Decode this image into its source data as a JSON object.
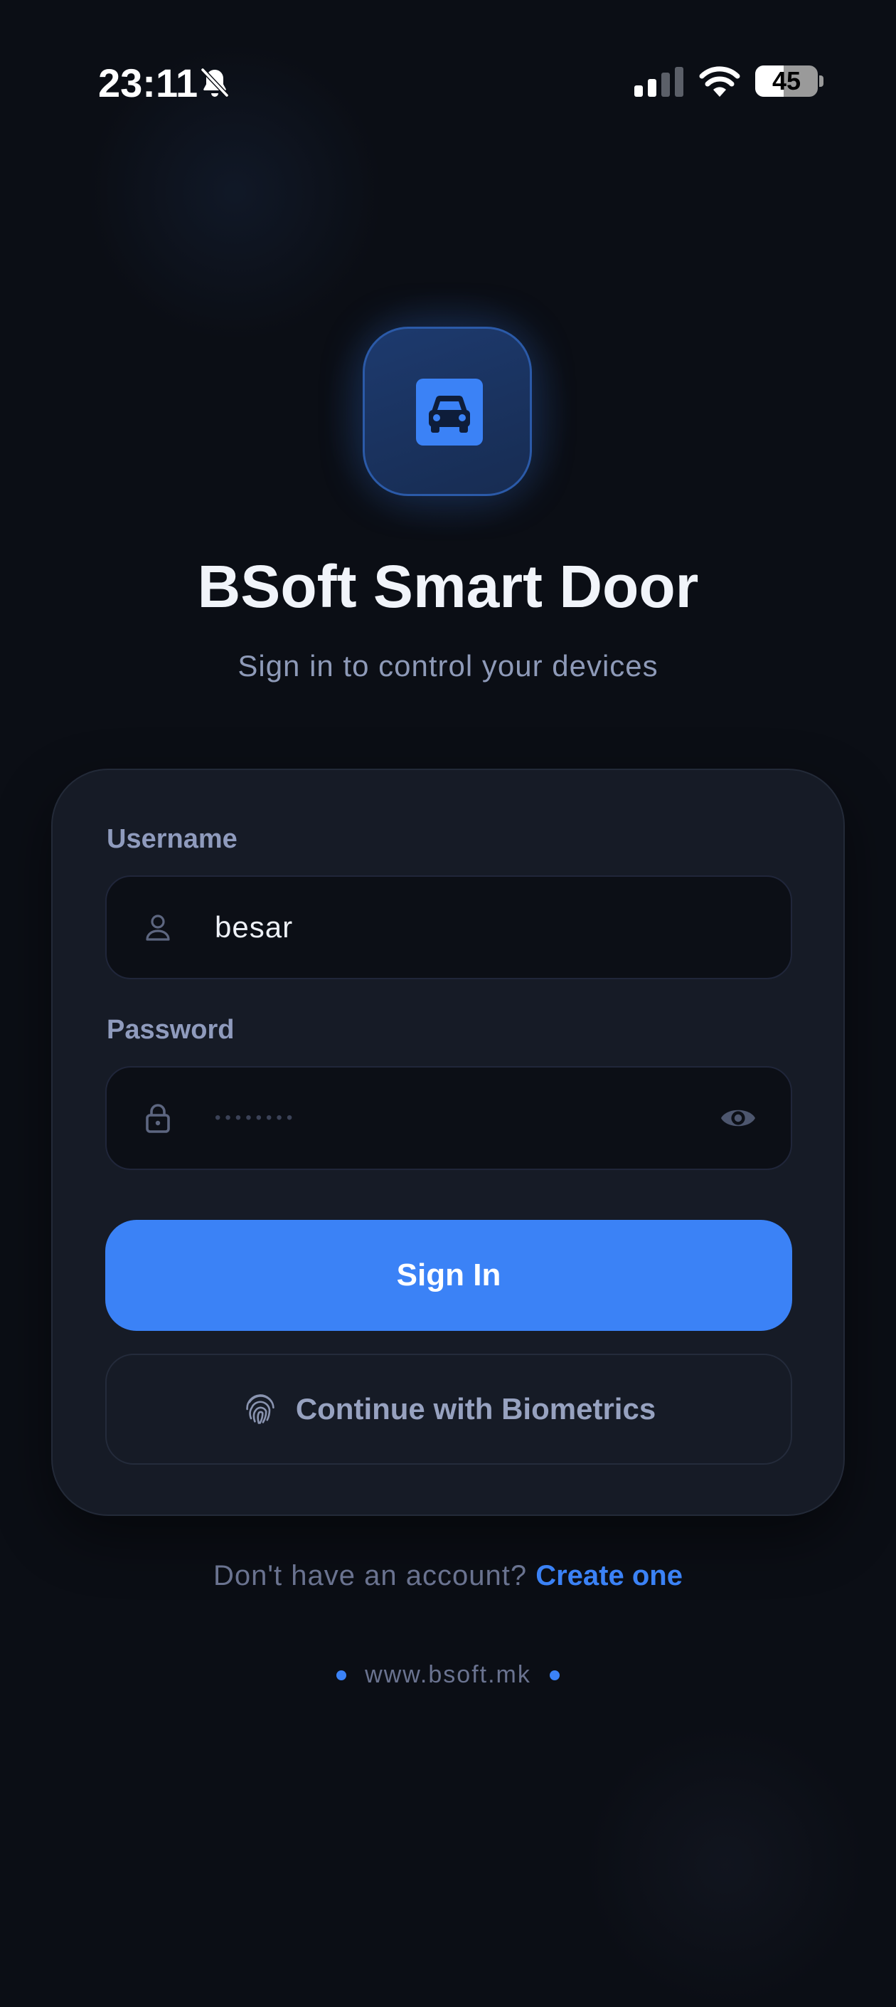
{
  "status_bar": {
    "time": "23:11",
    "battery_level": "45",
    "battery_fraction": 0.45,
    "icons": [
      "bell-slash-icon",
      "cellular-signal-icon",
      "wifi-icon",
      "battery-icon"
    ]
  },
  "app": {
    "logo_icon": "car-icon",
    "title": "BSoft Smart Door",
    "subtitle": "Sign in to control your devices"
  },
  "form": {
    "username": {
      "label": "Username",
      "value": "besar",
      "icon": "user-icon"
    },
    "password": {
      "label": "Password",
      "masked_value": "••••••••",
      "icon": "lock-icon",
      "toggle_icon": "eye-icon"
    },
    "sign_in_label": "Sign In",
    "biometrics_label": "Continue with Biometrics",
    "biometrics_icon": "fingerprint-icon"
  },
  "signup": {
    "prompt": "Don't have an account?",
    "link": "Create one"
  },
  "footer": {
    "website": "www.bsoft.mk"
  },
  "colors": {
    "background": "#0b0e15",
    "card": "#161b26",
    "accent": "#3b82f6",
    "label": "#8f9bbd",
    "muted": "#6a7390"
  }
}
